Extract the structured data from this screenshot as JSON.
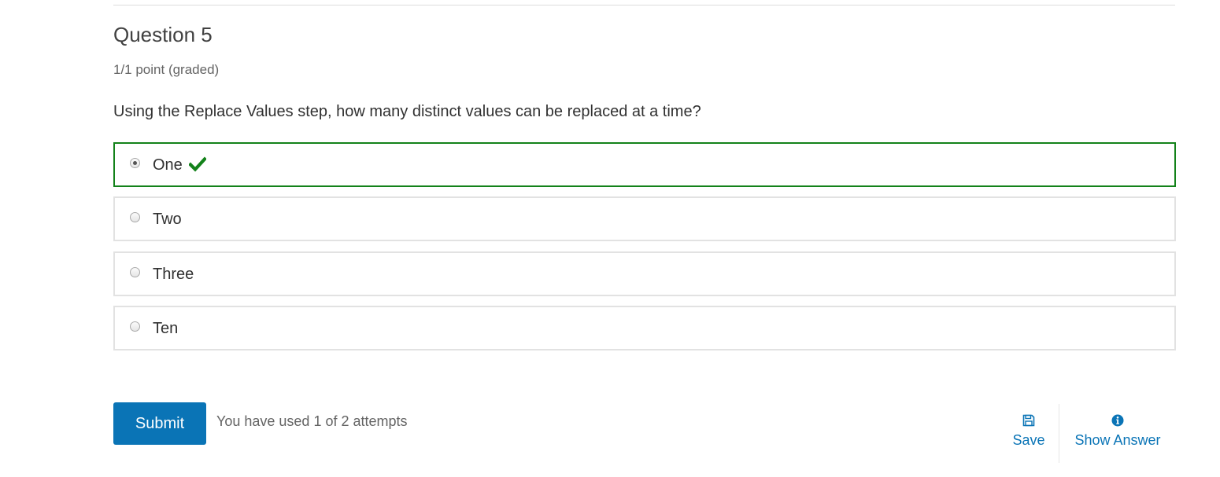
{
  "question": {
    "title": "Question 5",
    "points": "1/1 point (graded)",
    "prompt": "Using the Replace Values step, how many distinct values can be replaced at a time?"
  },
  "choices": [
    {
      "label": "One",
      "selected": true,
      "correct": true
    },
    {
      "label": "Two",
      "selected": false,
      "correct": false
    },
    {
      "label": "Three",
      "selected": false,
      "correct": false
    },
    {
      "label": "Ten",
      "selected": false,
      "correct": false
    }
  ],
  "actions": {
    "submit_label": "Submit",
    "attempts_text": "You have used 1 of 2 attempts",
    "save_label": "Save",
    "show_answer_label": "Show Answer"
  },
  "icons": {
    "correct": "checkmark-icon",
    "save": "floppy-disk-icon",
    "show_answer": "info-circle-icon"
  },
  "colors": {
    "accent": "#0a74b6",
    "correct": "#13821a",
    "border": "#e2e2e2"
  }
}
